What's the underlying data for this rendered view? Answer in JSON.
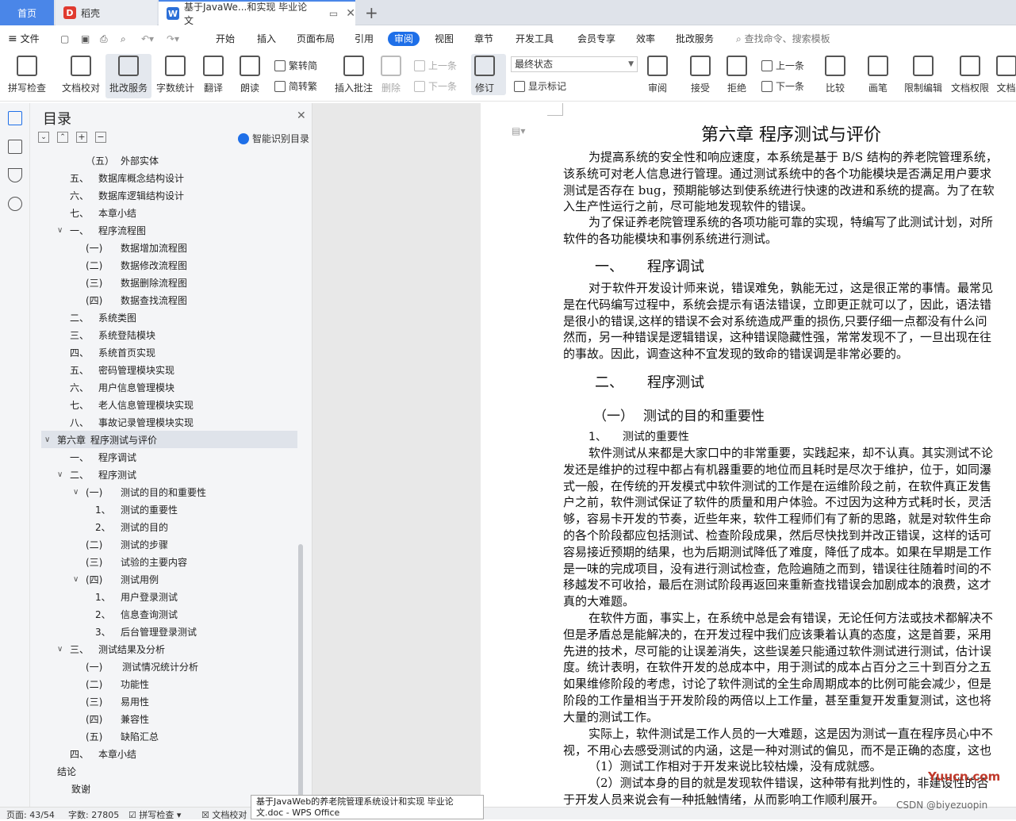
{
  "tabs": {
    "home": "首页",
    "daoke": "稻壳",
    "doc": "基于JavaWe...和实现 毕业论文",
    "new_tab": "+"
  },
  "menu": {
    "file": "文件",
    "start": "开始",
    "insert": "插入",
    "layout": "页面布局",
    "reference": "引用",
    "review": "审阅",
    "view": "视图",
    "chapter": "章节",
    "devtools": "开发工具",
    "member": "会员专享",
    "efficiency": "效率",
    "batch": "批改服务",
    "search_placeholder": "查找命令、搜索模板"
  },
  "ribbon": {
    "spell": "拼写检查",
    "doc_check": "文档校对",
    "batch_service": "批改服务",
    "word_count": "字数统计",
    "translate": "翻译",
    "read_aloud": "朗读",
    "trad_simp": "繁转简",
    "simp_trad": "简转繁",
    "insert_comment": "插入批注",
    "delete": "删除",
    "prev": "上一条",
    "next": "下一条",
    "track": "修订",
    "final_state": "最终状态",
    "show_marks": "显示标记",
    "review_pane": "审阅",
    "accept": "接受",
    "reject": "拒绝",
    "prev2": "上一条",
    "next2": "下一条",
    "compare": "比较",
    "pen": "画笔",
    "restrict": "限制编辑",
    "doc_perm": "文档权限",
    "doc_more": "文档"
  },
  "toc": {
    "title": "目录",
    "smart": "智能识别目录",
    "items": [
      {
        "num": "（五）",
        "text": "外部实体"
      },
      {
        "num": "五、",
        "text": "数据库概念结构设计"
      },
      {
        "num": "六、",
        "text": "数据库逻辑结构设计"
      },
      {
        "num": "七、",
        "text": "本章小结"
      },
      {
        "num": "一、",
        "text": "程序流程图"
      },
      {
        "num": "(一)",
        "text": "数据增加流程图"
      },
      {
        "num": "(二)",
        "text": "数据修改流程图"
      },
      {
        "num": "(三)",
        "text": "数据删除流程图"
      },
      {
        "num": "(四)",
        "text": "数据查找流程图"
      },
      {
        "num": "二、",
        "text": "系统类图"
      },
      {
        "num": "三、",
        "text": "系统登陆模块"
      },
      {
        "num": "四、",
        "text": "系统首页实现"
      },
      {
        "num": "五、",
        "text": "密码管理模块实现"
      },
      {
        "num": "六、",
        "text": "用户信息管理模块"
      },
      {
        "num": "七、",
        "text": "老人信息管理模块实现"
      },
      {
        "num": "八、",
        "text": "事故记录管理模块实现"
      },
      {
        "num": "第六章",
        "text": "程序测试与评价"
      },
      {
        "num": "一、",
        "text": "程序调试"
      },
      {
        "num": "二、",
        "text": "程序测试"
      },
      {
        "num": "(一)",
        "text": "测试的目的和重要性"
      },
      {
        "num": "1、",
        "text": "测试的重要性"
      },
      {
        "num": "2、",
        "text": "测试的目的"
      },
      {
        "num": "(二)",
        "text": "测试的步骤"
      },
      {
        "num": "(三)",
        "text": "试验的主要内容"
      },
      {
        "num": "(四)",
        "text": "测试用例"
      },
      {
        "num": "1、",
        "text": "用户登录测试"
      },
      {
        "num": "2、",
        "text": "信息查询测试"
      },
      {
        "num": "3、",
        "text": "后台管理登录测试"
      },
      {
        "num": "三、",
        "text": "测试结果及分析"
      },
      {
        "num": "(一)",
        "text": "测试情况统计分析"
      },
      {
        "num": "(二)",
        "text": "功能性"
      },
      {
        "num": "(三)",
        "text": "易用性"
      },
      {
        "num": "(四)",
        "text": "兼容性"
      },
      {
        "num": "(五)",
        "text": "缺陷汇总"
      },
      {
        "num": "四、",
        "text": "本章小结"
      },
      {
        "num": "",
        "text": "结论"
      },
      {
        "num": "",
        "text": "致谢"
      }
    ]
  },
  "doc": {
    "heading": "第六章  程序测试与评价",
    "p1": [
      "为提高系统的安全性和响应速度，本系统是基于 B/S 结构的养老院管理系统，",
      "该系统可对老人信息进行管理。通过测试系统中的各个功能模块是否满足用户要求",
      "测试是否存在 bug，预期能够达到使系统进行快速的改进和系统的提高。为了在软",
      "入生产性运行之前，尽可能地发现软件的错误。"
    ],
    "p2": [
      "为了保证养老院管理系统的各项功能可靠的实现，特编写了此测试计划，对所",
      "软件的各功能模块和事例系统进行测试。"
    ],
    "h_debug_num": "一、",
    "h_debug": "程序调试",
    "p3": [
      "对于软件开发设计师来说，错误难免，孰能无过，这是很正常的事情。最常见",
      "是在代码编写过程中，系统会提示有语法错误，立即更正就可以了，因此，语法错",
      "是很小的错误,这样的错误不会对系统造成严重的损伤,只要仔细一点都没有什么问",
      "然而，另一种错误是逻辑错误，这种错误隐藏性强，常常发现不了，一旦出现在往",
      "的事故。因此，调查这种不宜发现的致命的错误调是非常必要的。"
    ],
    "h_test_num": "二、",
    "h_test": "程序测试",
    "h_purpose_num": "（一）",
    "h_purpose": "测试的目的和重要性",
    "h_importance_num": "1、",
    "h_importance": "测试的重要性",
    "p4": [
      "软件测试从来都是大家口中的非常重要，实践起来，却不认真。其实测试不论",
      "发还是维护的过程中都占有机器重要的地位而且耗时是尽次于维护，位于，如同瀑",
      "式一般，在传统的开发模式中软件测试的工作是在运维阶段之前，在软件真正发售",
      "户之前，软件测试保证了软件的质量和用户体验。不过因为这种方式耗时长，灵活",
      "够，容易卡开发的节奏，近些年来，软件工程师们有了新的思路，就是对软件生命",
      "的各个阶段都应包括测试、检查阶段成果，然后尽快找到并改正错误，这样的话可",
      "容易接近预期的结果，也为后期测试降低了难度，降低了成本。如果在早期是工作",
      "是一味的完成项目，没有进行测试检查，危险遍随之而到，错误往往随着时间的不",
      "移越发不可收拾，最后在测试阶段再返回来重新查找错误会加剧成本的浪费，这才",
      "真的大难题。"
    ],
    "p5": [
      "在软件方面，事实上，在系统中总是会有错误，无论任何方法或技术都解决不",
      "但是矛盾总是能解决的，在开发过程中我们应该秉着认真的态度，这是首要，采用",
      "先进的技术，尽可能的让误差消失，这些误差只能通过软件测试进行测试，估计误",
      "度。统计表明，在软件开发的总成本中，用于测试的成本占百分之三十到百分之五",
      "如果维修阶段的考虑，讨论了软件测试的全生命周期成本的比例可能会减少，但是",
      "阶段的工作量相当于开发阶段的两倍以上工作量，甚至重复开发重复测试，这也将",
      "大量的测试工作。"
    ],
    "p6": [
      "实际上，软件测试是工作人员的一大难题，这是因为测试一直在程序员心中不",
      "视，不用心去感受测试的内涵，这是一种对测试的偏见，而不是正确的态度，这也"
    ],
    "l1": "（1）测试工作相对于开发来说比较枯燥，没有成就感。",
    "l2": "（2）测试本身的目的就是发现软件错误，这种带有批判性的，非建设性的否",
    "l3": "于开发人员来说会有一种抵触情绪，从而影响工作顺利展开。"
  },
  "status": {
    "page": "页面: 43/54",
    "words": "字数: 27805",
    "spell": "拼写检查",
    "proof": "文档校对"
  },
  "tooltip": "基于JavaWeb的养老院管理系统设计和实现 毕业论文.doc - WPS Office",
  "watermark": {
    "site": "Yuucn.com",
    "csdn": "CSDN @biyezuopin"
  },
  "colors": {
    "accent": "#1e6fe8",
    "home_tab": "#4a86e8",
    "daoke": "#e03a2f"
  }
}
